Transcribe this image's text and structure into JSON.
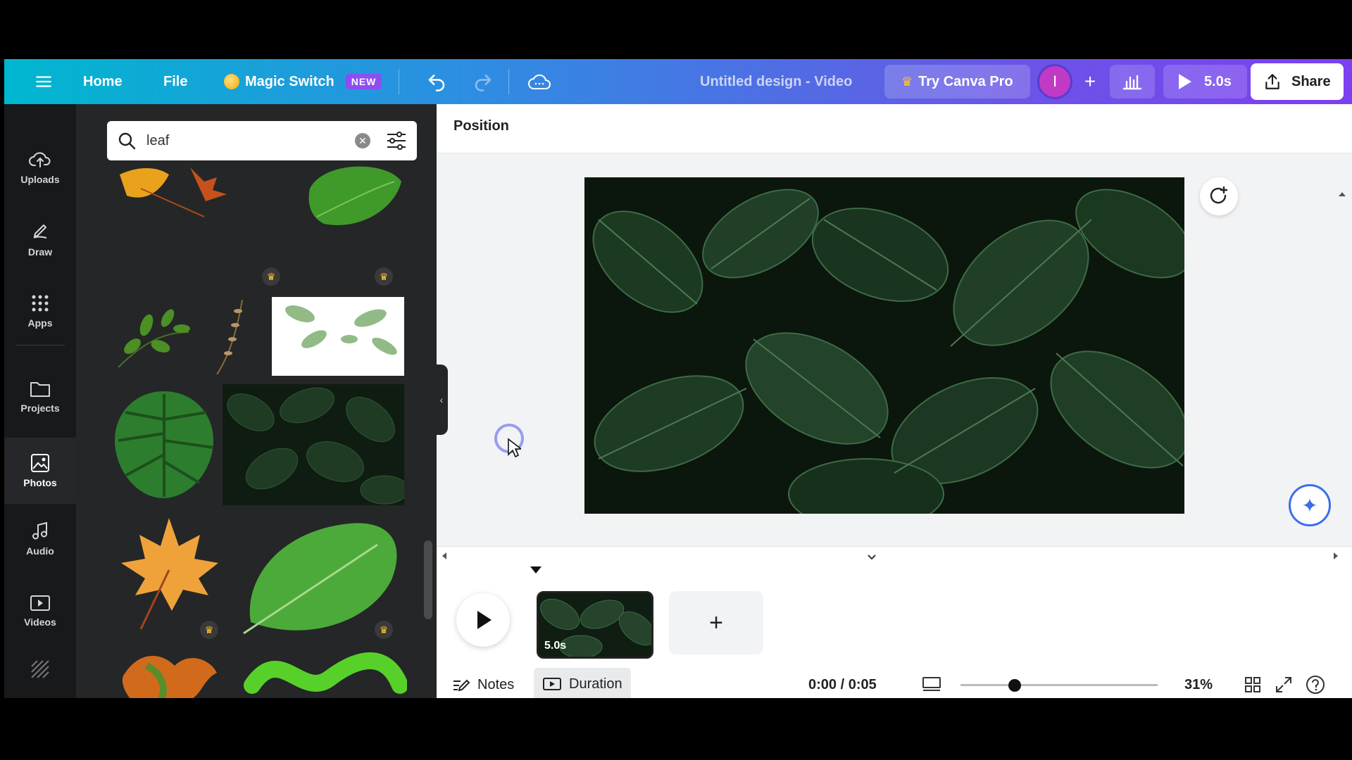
{
  "topbar": {
    "home": "Home",
    "file": "File",
    "magic_switch": "Magic Switch",
    "new_badge": "NEW",
    "title": "Untitled design - Video",
    "try_pro": "Try Canva Pro",
    "avatar_initial": "I",
    "play_duration": "5.0s",
    "share": "Share"
  },
  "rail": {
    "items": [
      {
        "label": "Uploads",
        "icon": "upload-cloud-icon"
      },
      {
        "label": "Draw",
        "icon": "draw-icon"
      },
      {
        "label": "Apps",
        "icon": "apps-grid-icon"
      },
      {
        "label": "Projects",
        "icon": "folder-icon"
      },
      {
        "label": "Photos",
        "icon": "photo-icon"
      },
      {
        "label": "Audio",
        "icon": "music-icon"
      },
      {
        "label": "Videos",
        "icon": "video-icon"
      }
    ]
  },
  "panel": {
    "search_value": "leaf"
  },
  "workspace": {
    "context_label": "Position"
  },
  "timeline": {
    "clip_duration": "5.0s",
    "notes": "Notes",
    "duration": "Duration",
    "timecode": "0:00 / 0:05",
    "zoom": "31%"
  },
  "colors": {
    "topbar_start": "#00b7cf",
    "topbar_end": "#7d3ff2",
    "panel_bg": "#252627",
    "rail_bg": "#18191b",
    "pro_crown": "#ffc72c"
  }
}
